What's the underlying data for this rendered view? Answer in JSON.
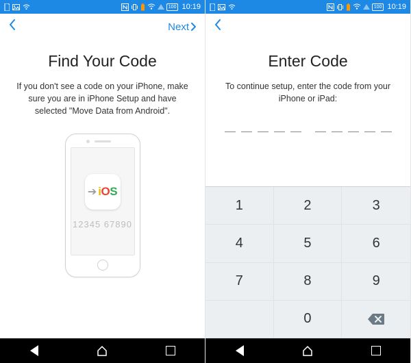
{
  "statusbar": {
    "time": "10:19",
    "battery": "100"
  },
  "left": {
    "nav": {
      "next": "Next"
    },
    "title": "Find Your Code",
    "subtitle": "If you don't see a code on your iPhone, make sure you are in iPhone Setup and have selected \"Move Data from Android\".",
    "phone": {
      "ios_label_i": "i",
      "ios_label_o": "O",
      "ios_label_s": "S",
      "sample_code": "12345 67890"
    }
  },
  "right": {
    "title": "Enter Code",
    "subtitle": "To continue setup, enter the code from your iPhone or iPad:",
    "keypad": {
      "k1": "1",
      "k2": "2",
      "k3": "3",
      "k4": "4",
      "k5": "5",
      "k6": "6",
      "k7": "7",
      "k8": "8",
      "k9": "9",
      "k0": "0"
    }
  }
}
